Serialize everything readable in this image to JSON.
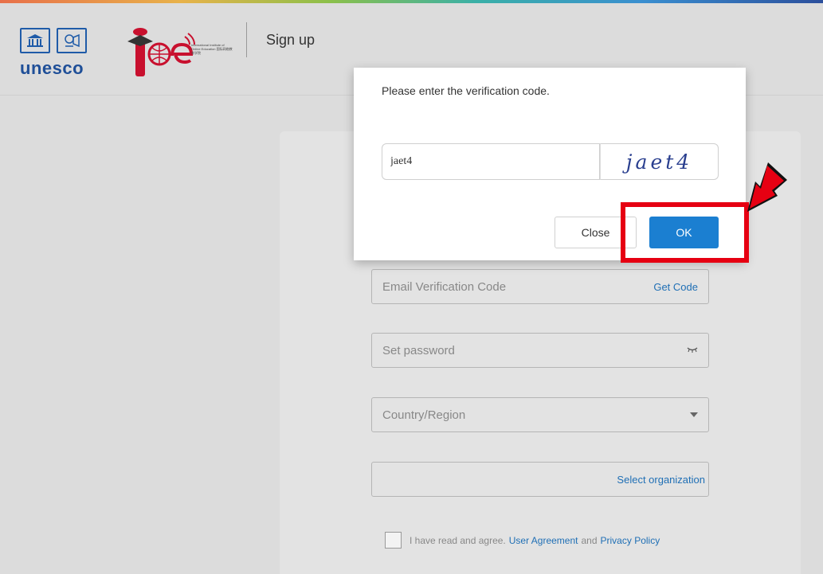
{
  "header": {
    "unesco_text": "unesco",
    "iioe_small_text": "International Institute of Online Education 国际网络教育学院",
    "title": "Sign up"
  },
  "form": {
    "email_code_placeholder": "Email Verification Code",
    "get_code_label": "Get Code",
    "password_placeholder": "Set password",
    "country_placeholder": "Country/Region",
    "select_org_label": "Select organization",
    "agree_text": "I have read and agree.",
    "user_agreement_label": "User Agreement",
    "and_text": "and",
    "privacy_policy_label": "Privacy Policy"
  },
  "modal": {
    "title": "Please enter the verification code.",
    "code_value": "jaet4",
    "captcha_text": "jaet4",
    "close_label": "Close",
    "ok_label": "OK"
  },
  "colors": {
    "accent": "#1b7fd1",
    "link": "#1f6fb5",
    "annotation": "#e60012",
    "unesco_blue": "#1f4f98",
    "iioe_red": "#c8102e"
  },
  "icons": {
    "password_toggle": "eye-closed-icon",
    "country_dropdown": "caret-down-icon",
    "annotation_arrow": "red-arrow-icon"
  }
}
